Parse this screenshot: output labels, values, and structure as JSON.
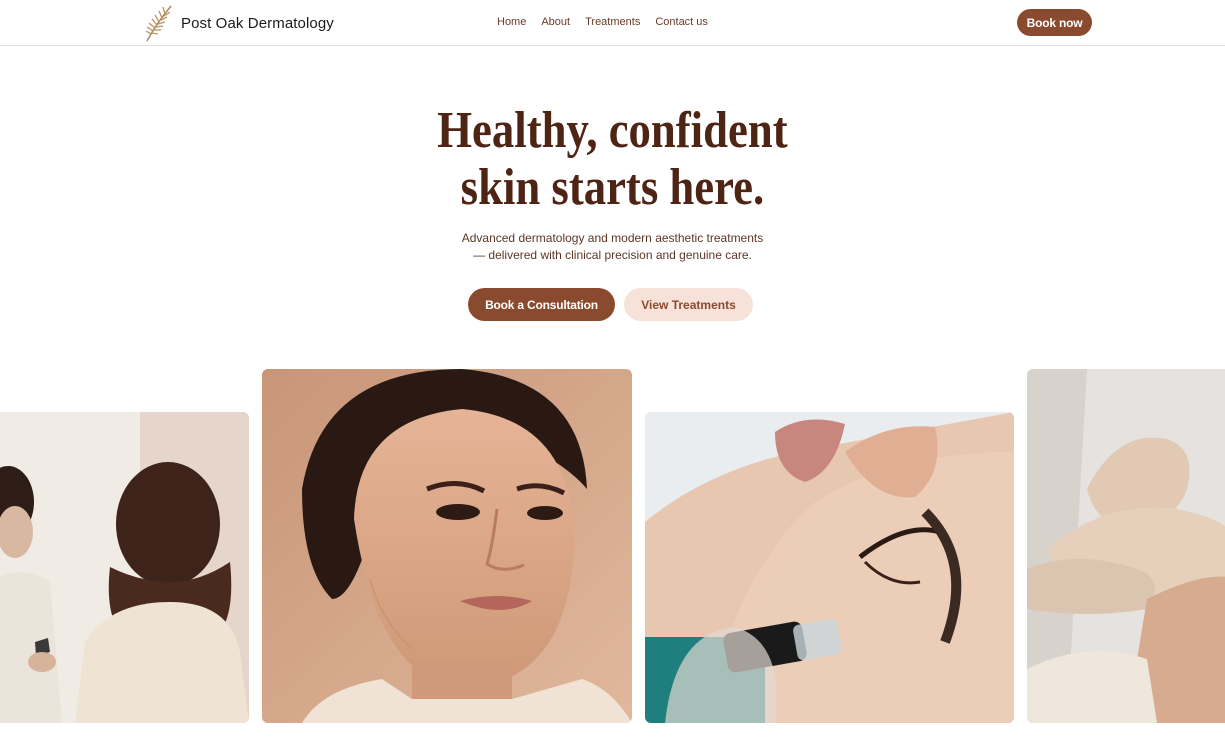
{
  "brand": {
    "name": "Post Oak Dermatology",
    "logo_icon": "leaf-icon",
    "accent": "#8a4a2e",
    "accent_light": "#f6e2d8",
    "heading_color": "#4e2414"
  },
  "nav": {
    "links": [
      "Home",
      "About",
      "Treatments",
      "Contact us"
    ],
    "book_label": "Book now"
  },
  "hero": {
    "title_line1": "Healthy, confident",
    "title_line2": "skin starts here.",
    "subtitle_line1": "Advanced dermatology and modern aesthetic treatments",
    "subtitle_line2": "— delivered with clinical precision and genuine care.",
    "primary_cta": "Book a Consultation",
    "secondary_cta": "View Treatments"
  },
  "gallery": [
    {
      "name": "photo-consultation"
    },
    {
      "name": "photo-portrait"
    },
    {
      "name": "photo-microneedling"
    },
    {
      "name": "photo-gloved-treatment"
    }
  ]
}
